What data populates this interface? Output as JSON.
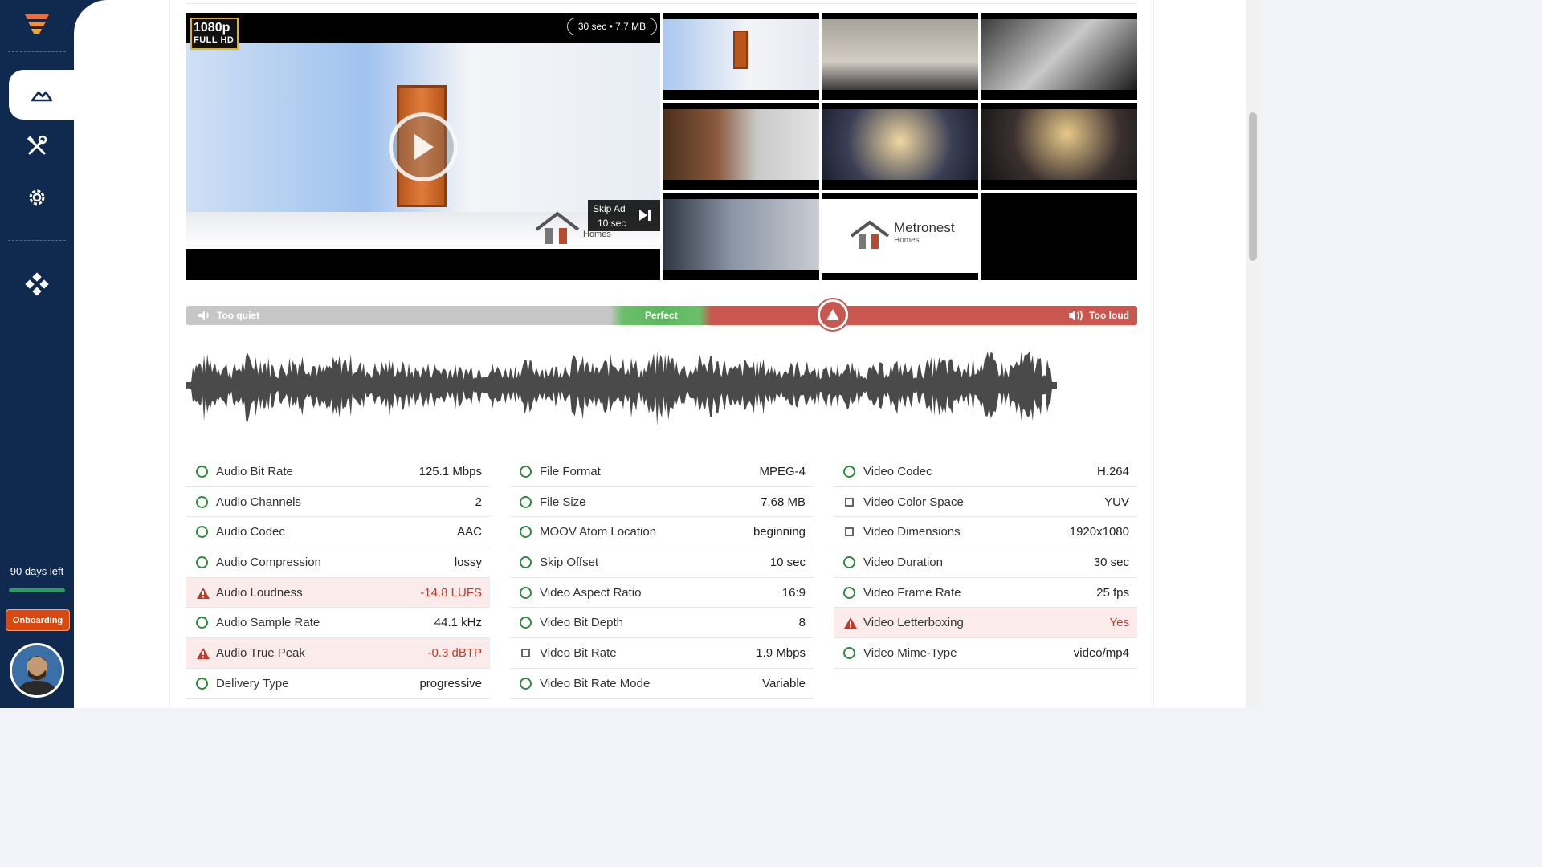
{
  "sidebar": {
    "nav": [
      {
        "name": "media-icon",
        "active": true
      },
      {
        "name": "tools-icon",
        "active": false
      },
      {
        "name": "gear-icon",
        "active": false
      },
      {
        "name": "integrations-icon",
        "active": false
      }
    ],
    "trial_text": "90 days left",
    "onboarding_label": "Onboarding"
  },
  "video": {
    "quality": "1080p",
    "quality_sub": "FULL HD",
    "duration_size": "30 sec • 7.7 MB",
    "skip_label": "Skip Ad",
    "skip_countdown": "10 sec",
    "brand_fragment": "Homes"
  },
  "thumb_brand": {
    "name": "Metronest",
    "sub": "Homes"
  },
  "meter": {
    "quiet_label": "Too quiet",
    "perfect_label": "Perfect",
    "loud_label": "Too loud",
    "colors": {
      "quiet": "#c6c6c6",
      "perfect": "#5cb85c",
      "loud": "#c9574f"
    }
  },
  "stats": {
    "col1": [
      {
        "label": "Audio Bit Rate",
        "value": "125.1 Mbps",
        "status": "ok"
      },
      {
        "label": "Audio Channels",
        "value": "2",
        "status": "ok"
      },
      {
        "label": "Audio Codec",
        "value": "AAC",
        "status": "ok"
      },
      {
        "label": "Audio Compression",
        "value": "lossy",
        "status": "ok"
      },
      {
        "label": "Audio Loudness",
        "value": "-14.8 LUFS",
        "status": "warn"
      },
      {
        "label": "Audio Sample Rate",
        "value": "44.1 kHz",
        "status": "ok"
      },
      {
        "label": "Audio True Peak",
        "value": "-0.3 dBTP",
        "status": "warn"
      },
      {
        "label": "Delivery Type",
        "value": "progressive",
        "status": "ok"
      }
    ],
    "col2": [
      {
        "label": "File Format",
        "value": "MPEG-4",
        "status": "ok"
      },
      {
        "label": "File Size",
        "value": "7.68 MB",
        "status": "ok"
      },
      {
        "label": "MOOV Atom Location",
        "value": "beginning",
        "status": "ok"
      },
      {
        "label": "Skip Offset",
        "value": "10 sec",
        "status": "ok"
      },
      {
        "label": "Video Aspect Ratio",
        "value": "16:9",
        "status": "ok"
      },
      {
        "label": "Video Bit Depth",
        "value": "8",
        "status": "ok"
      },
      {
        "label": "Video Bit Rate",
        "value": "1.9 Mbps",
        "status": "info"
      },
      {
        "label": "Video Bit Rate Mode",
        "value": "Variable",
        "status": "ok"
      }
    ],
    "col3": [
      {
        "label": "Video Codec",
        "value": "H.264",
        "status": "ok"
      },
      {
        "label": "Video Color Space",
        "value": "YUV",
        "status": "info"
      },
      {
        "label": "Video Dimensions",
        "value": "1920x1080",
        "status": "info"
      },
      {
        "label": "Video Duration",
        "value": "30 sec",
        "status": "ok"
      },
      {
        "label": "Video Frame Rate",
        "value": "25 fps",
        "status": "ok"
      },
      {
        "label": "Video Letterboxing",
        "value": "Yes",
        "status": "warn"
      },
      {
        "label": "Video Mime-Type",
        "value": "video/mp4",
        "status": "ok"
      }
    ]
  }
}
